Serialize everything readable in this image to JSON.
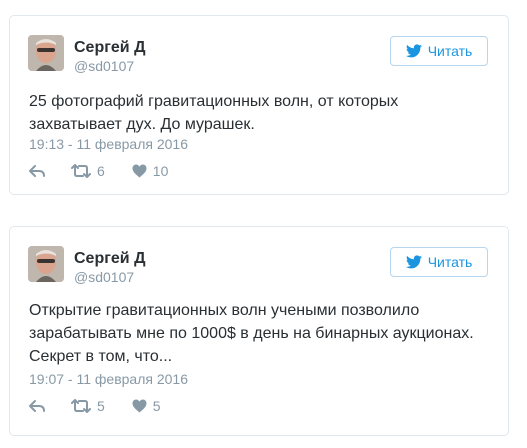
{
  "colors": {
    "accent": "#1b95e0",
    "muted": "#8899a6",
    "text": "#292f33",
    "border": "#e1e8ed"
  },
  "tweets": [
    {
      "name": "Сергей Д",
      "handle": "@sd0107",
      "follow_label": "Читать",
      "text": "25 фотографий гравитационных волн, от которых захватывает дух. До мурашек.",
      "time": "19:13 - 11 февраля 2016",
      "retweets": "6",
      "likes": "10",
      "icons": [
        "twitter-bird-icon",
        "reply-icon",
        "retweet-icon",
        "heart-icon"
      ]
    },
    {
      "name": "Сергей Д",
      "handle": "@sd0107",
      "follow_label": "Читать",
      "text": "Открытие гравитационных волн учеными позволило зарабатывать мне по 1000$ в день на бинарных аукционах. Секрет в том, что...",
      "time": "19:07 - 11 февраля 2016",
      "retweets": "5",
      "likes": "5",
      "icons": [
        "twitter-bird-icon",
        "reply-icon",
        "retweet-icon",
        "heart-icon"
      ]
    }
  ]
}
